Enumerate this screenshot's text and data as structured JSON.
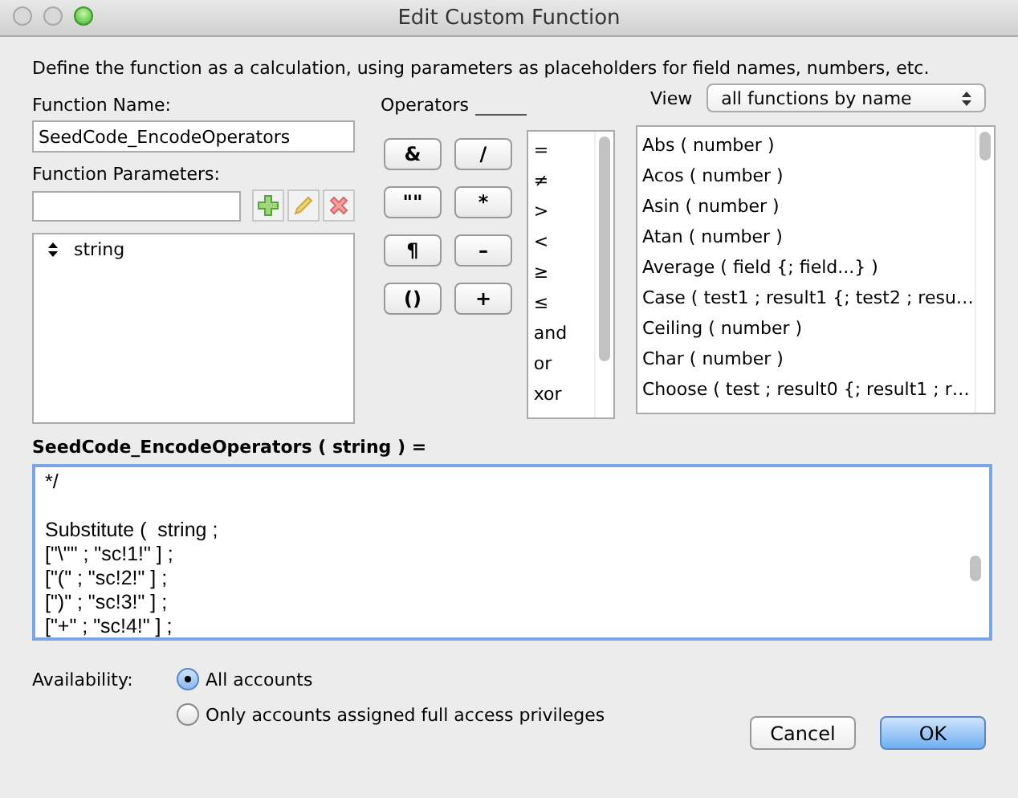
{
  "window": {
    "title": "Edit Custom Function"
  },
  "description": "Define the function as a calculation, using parameters as placeholders for field names, numbers, etc.",
  "function_name": {
    "label": "Function Name:",
    "value": "SeedCode_EncodeOperators"
  },
  "function_parameters": {
    "label": "Function Parameters:",
    "items": [
      {
        "name": "string",
        "selected": false
      }
    ]
  },
  "operators": {
    "label": "Operators",
    "buttons": [
      "&",
      "/",
      "\"\"",
      "*",
      "¶",
      "–",
      "()",
      "+"
    ],
    "list": [
      "=",
      "≠",
      ">",
      "<",
      "≥",
      "≤",
      "and",
      "or",
      "xor"
    ]
  },
  "view": {
    "label": "View",
    "value": "all functions by name"
  },
  "functions": [
    "Abs ( number )",
    "Acos ( number )",
    "Asin ( number )",
    "Atan ( number )",
    "Average ( field {; field...} )",
    "Case ( test1 ; result1 {; test2 ; resu…",
    "Ceiling ( number )",
    "Char ( number )",
    "Choose ( test ; result0 {; result1 ; r…"
  ],
  "calculation": {
    "heading": "SeedCode_EncodeOperators ( string ) =",
    "blocks": [
      [
        "*/"
      ],
      [
        "Substitute (  string ;",
        "[\"\\\"\" ; \"sc!1!\" ] ;",
        "[\"(\" ; \"sc!2!\" ] ;",
        "[\")\" ; \"sc!3!\" ] ;",
        "[\"+\" ; \"sc!4!\" ] ;"
      ]
    ]
  },
  "availability": {
    "label": "Availability:",
    "options": [
      {
        "label": "All accounts",
        "selected": true
      },
      {
        "label": "Only accounts assigned full access privileges",
        "selected": false
      }
    ]
  },
  "buttons": [
    {
      "label": "Cancel",
      "kind": "secondary"
    },
    {
      "label": "OK",
      "kind": "default"
    }
  ]
}
